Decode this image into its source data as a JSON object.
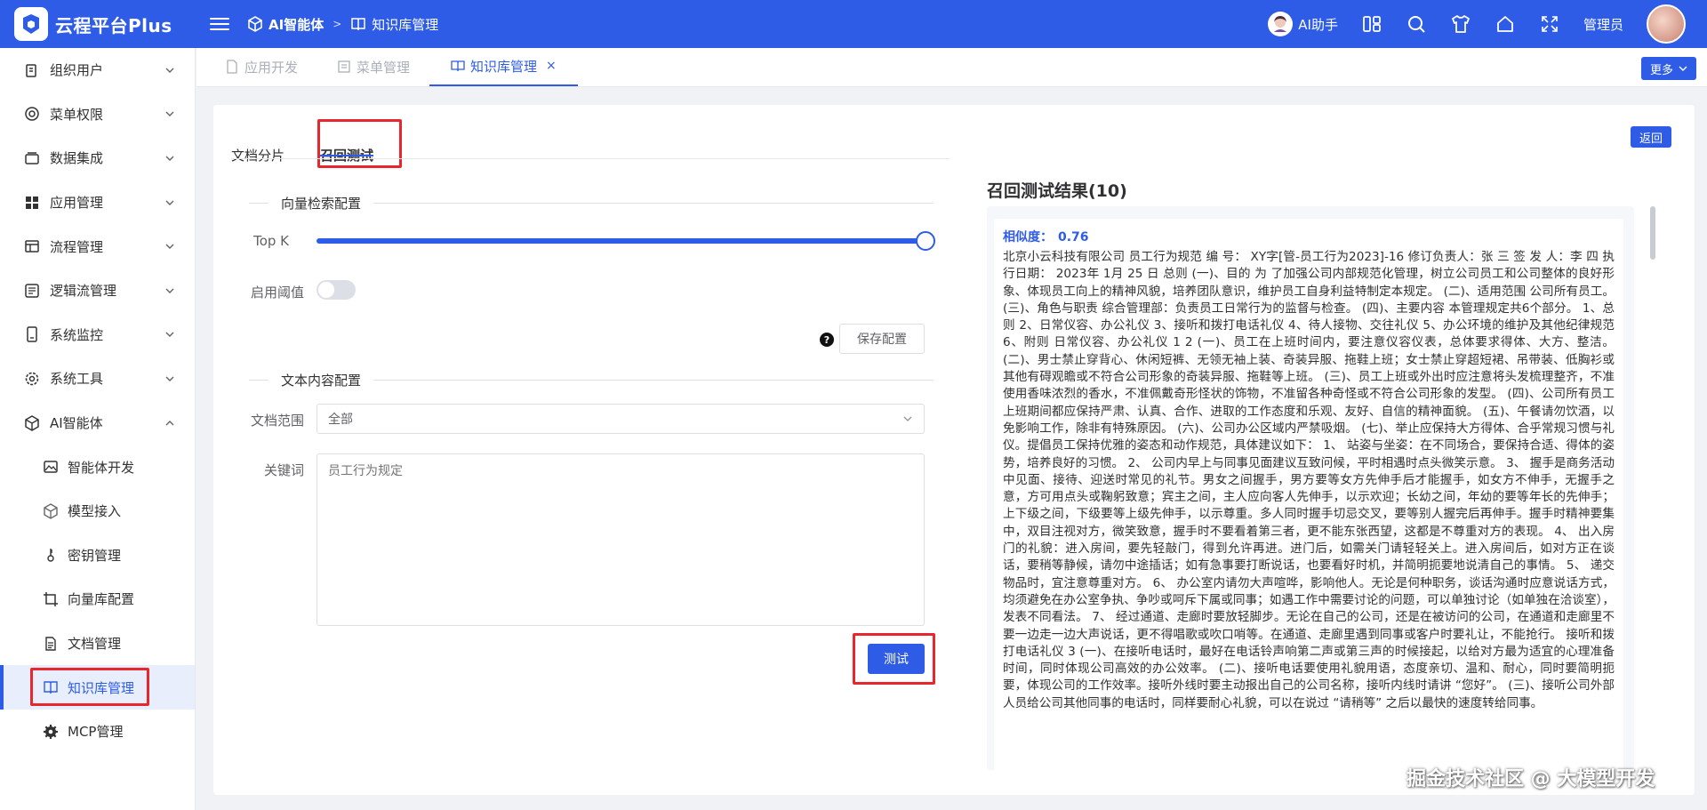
{
  "header": {
    "app_title": "云程平台Plus",
    "breadcrumb": [
      "AI智能体",
      "知识库管理"
    ],
    "ai_help": "AI助手",
    "admin": "管理员"
  },
  "sidebar": {
    "items": [
      {
        "label": "组织用户",
        "icon": "users-icon"
      },
      {
        "label": "菜单权限",
        "icon": "menu-permission-icon"
      },
      {
        "label": "数据集成",
        "icon": "database-icon"
      },
      {
        "label": "应用管理",
        "icon": "apps-icon"
      },
      {
        "label": "流程管理",
        "icon": "flow-icon"
      },
      {
        "label": "逻辑流管理",
        "icon": "logic-flow-icon"
      },
      {
        "label": "系统监控",
        "icon": "monitor-icon"
      },
      {
        "label": "系统工具",
        "icon": "gear-icon"
      },
      {
        "label": "AI智能体",
        "icon": "ai-agent-icon"
      }
    ],
    "subitems": [
      {
        "label": "智能体开发",
        "icon": "image-icon"
      },
      {
        "label": "模型接入",
        "icon": "cube-icon"
      },
      {
        "label": "密钥管理",
        "icon": "key-icon"
      },
      {
        "label": "向量库配置",
        "icon": "crop-icon"
      },
      {
        "label": "文档管理",
        "icon": "document-icon"
      },
      {
        "label": "知识库管理",
        "icon": "book-icon"
      },
      {
        "label": "MCP管理",
        "icon": "gear-icon"
      }
    ]
  },
  "page_tabs": [
    {
      "label": "应用开发"
    },
    {
      "label": "菜单管理"
    },
    {
      "label": "知识库管理",
      "close": "×"
    }
  ],
  "more_label": "更多",
  "inner_tabs": [
    "文档分片",
    "召回测试"
  ],
  "back_label": "返回",
  "vector": {
    "section_title": "向量检索配置",
    "topk_label": "Top K",
    "topk_fill": 1.0,
    "threshold_label": "启用阈值",
    "threshold_enabled": false,
    "save_label": "保存配置",
    "help": "?"
  },
  "text": {
    "section_title": "文本内容配置",
    "scope_label": "文档范围",
    "scope_value": "全部",
    "keyword_label": "关键词",
    "keyword_placeholder": "员工行为规定",
    "test_label": "测试"
  },
  "results": {
    "title": "召回测试结果(10)",
    "similarity_label": "相似度：",
    "similarity_value": "0.76",
    "text": "北京小云科技有限公司 员工行为规范 编 号： XY字[管-员工行为2023]-16 修订负责人：张 三 签 发 人：李 四 执行日期： 2023年 1月 25 日 总则 (一)、目的 为 了加强公司内部规范化管理，树立公司员工和公司整体的良好形象、体现员工向上的精神风貌，培养团队意识，维护员工自身利益特制定本规定。 (二)、适用范围 公司所有员工。 (三)、角色与职责 综合管理部：负责员工日常行为的监督与检查。 (四)、主要内容 本管理规定共6个部分。 1、总则 2、日常仪容、办公礼仪 3、接听和拨打电话礼仪 4、待人接物、交往礼仪 5、办公环境的维护及其他纪律规范 6、附则 日常仪容、办公礼仪 1 2 (一)、员工在上班时间内，要注意仪容仪表，总体要求得体、大方、整洁。 (二)、男士禁止穿背心、休闲短裤、无领无袖上装、奇装异服、拖鞋上班；女士禁止穿超短裙、吊带装、低胸衫或其他有碍观瞻或不符合公司形象的奇装异服、拖鞋等上班。 (三)、员工上班或外出时应注意将头发梳理整齐，不准使用香味浓烈的香水，不准佩戴奇形怪状的饰物，不准留各种奇怪或不符合公司形象的发型。 (四)、公司所有员工上班期间都应保持严肃、认真、合作、进取的工作态度和乐观、友好、自信的精神面貌。 (五)、午餐请勿饮酒，以免影响工作，除非有特殊原因。 (六)、公司办公区域内严禁吸烟。 (七)、举止应保持大方得体、合乎常规习惯与礼仪。提倡员工保持优雅的姿态和动作规范，具体建议如下： 1、 站姿与坐姿：在不同场合，要保持合适、得体的姿势，培养良好的习惯。 2、 公司内早上与同事见面建议互致问候，平时相遇时点头微笑示意。 3、 握手是商务活动中见面、接待、迎送时常见的礼节。男女之间握手，男方要等女方先伸手后才能握手，如女方不伸手，无握手之意，方可用点头或鞠躬致意；宾主之间，主人应向客人先伸手，以示欢迎；长幼之间，年幼的要等年长的先伸手；上下级之间，下级要等上级先伸手，以示尊重。多人同时握手切忌交叉，要等别人握完后再伸手。握手时精神要集中，双目注视对方，微笑致意，握手时不要看着第三者，更不能东张西望，这都是不尊重对方的表现。 4、 出入房门的礼貌：进入房间，要先轻敲门，得到允许再进。进门后，如需关门请轻轻关上。进入房间后，如对方正在谈话，要稍等静候，请勿中途插话；如有急事要打断说话，也要看好时机，并简明扼要地说清自己的事情。 5、 递交物品时，宜注意尊重对方。 6、 办公室内请勿大声喧哗，影响他人。无论是何种职务，谈话沟通时应意说话方式，均须避免在办公室争执、争吵或呵斥下属或同事；如遇工作中需要讨论的问题，可以单独讨论（如单独在洽谈室），发表不同看法。 7、 经过通道、走廊时要放轻脚步。无论在自己的公司，还是在被访问的公司，在通道和走廊里不要一边走一边大声说话，更不得唱歌或吹口哨等。在通道、走廊里遇到同事或客户时要礼让，不能抢行。 接听和拨打电话礼仪 3 (一)、在接听电话时，最好在电话铃声响第二声或第三声的时候接起，以给对方最为适宜的心理准备时间，同时体现公司高效的办公效率。 (二)、接听电话要使用礼貌用语，态度亲切、温和、耐心，同时要简明扼要，体现公司的工作效率。接听外线时要主动报出自己的公司名称，接听内线时请讲 “您好”。 (三)、接听公司外部人员给公司其他同事的电话时，同样要耐心礼貌，可以在说过 “请稍等” 之后以最快的速度转给同事。"
  },
  "watermark": "掘金技术社区 @ 大模型开发"
}
